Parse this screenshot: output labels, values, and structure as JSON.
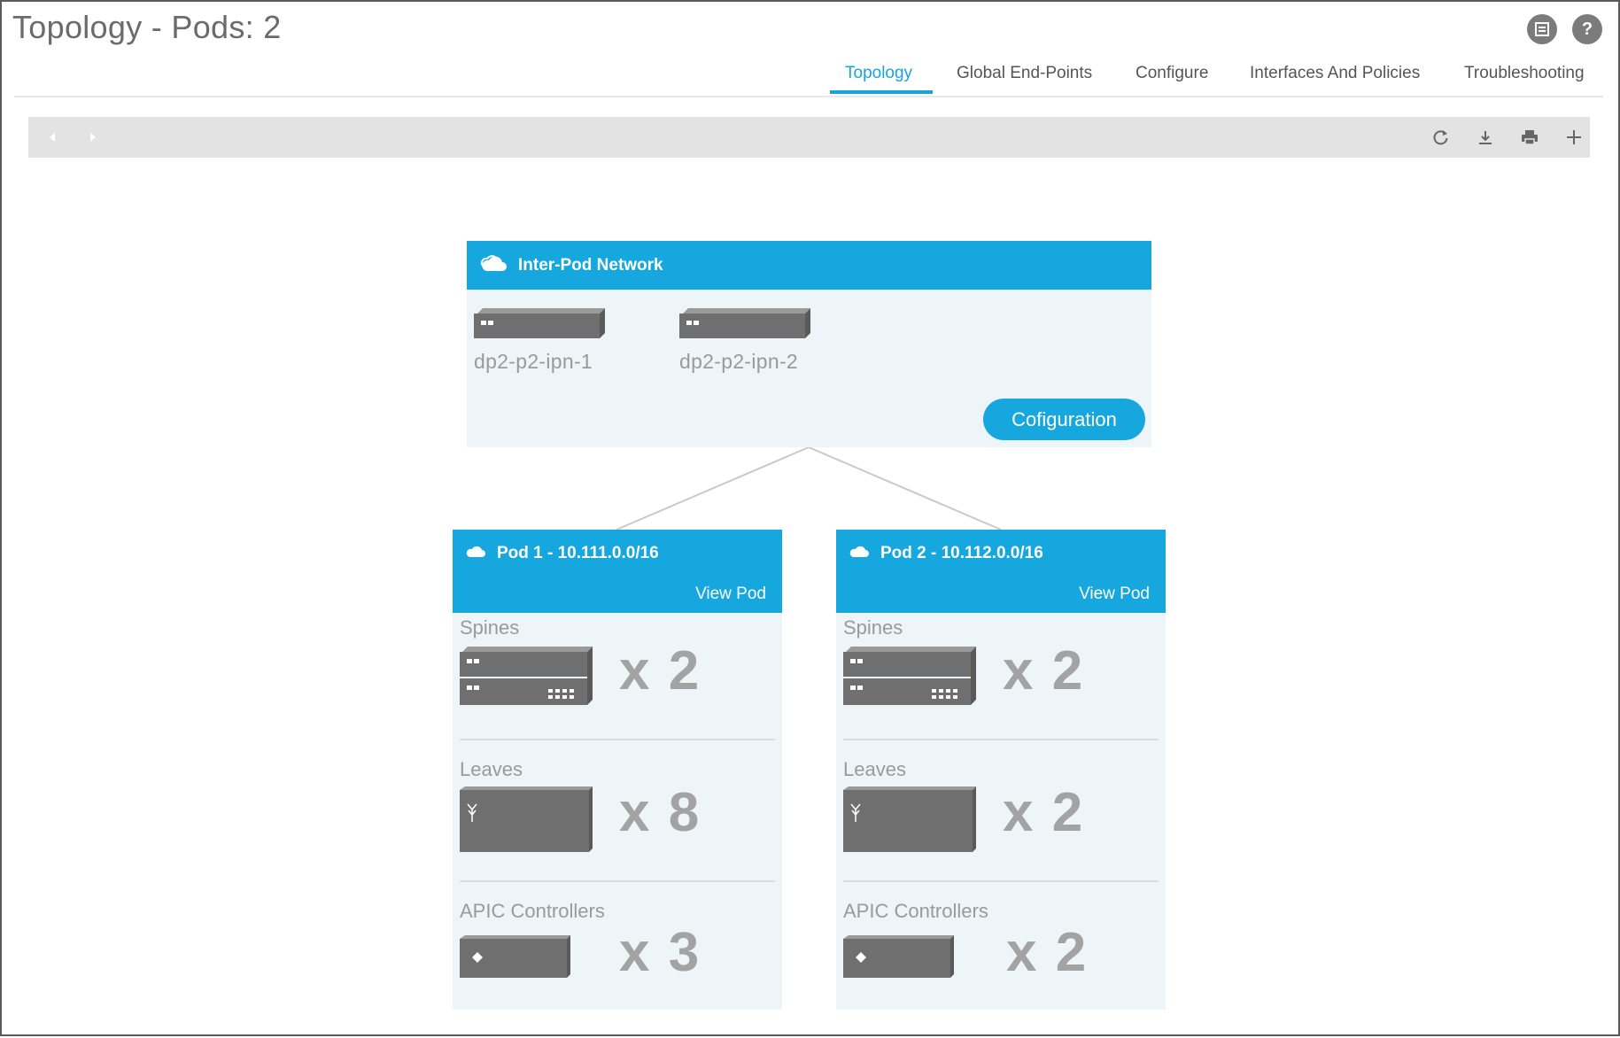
{
  "header": {
    "title": "Topology - Pods: 2"
  },
  "tabs": [
    {
      "label": "Topology",
      "active": true
    },
    {
      "label": "Global End-Points",
      "active": false
    },
    {
      "label": "Configure",
      "active": false
    },
    {
      "label": "Interfaces And Policies",
      "active": false
    },
    {
      "label": "Troubleshooting",
      "active": false
    }
  ],
  "toolbar": {
    "icons": [
      "back-arrow-icon",
      "forward-arrow-icon",
      "refresh-icon",
      "download-icon",
      "print-icon",
      "add-icon"
    ]
  },
  "ipn": {
    "title": "Inter-Pod Network",
    "nodes": [
      "dp2-p2-ipn-1",
      "dp2-p2-ipn-2"
    ],
    "config_button": "Cofiguration"
  },
  "pods": [
    {
      "title": "Pod 1 - 10.111.0.0/16",
      "view_link": "View Pod",
      "spines": {
        "label": "Spines",
        "count": "x 2"
      },
      "leaves": {
        "label": "Leaves",
        "count": "x 8"
      },
      "apic": {
        "label": "APIC Controllers",
        "count": "x 3"
      }
    },
    {
      "title": "Pod 2 - 10.112.0.0/16",
      "view_link": "View Pod",
      "spines": {
        "label": "Spines",
        "count": "x 2"
      },
      "leaves": {
        "label": "Leaves",
        "count": "x 2"
      },
      "apic": {
        "label": "APIC Controllers",
        "count": "x 2"
      }
    }
  ],
  "colors": {
    "accent": "#17a7df",
    "panel_bg": "#edf5f9",
    "device_gray": "#6f6f6f",
    "count_gray": "#a3a3a3"
  }
}
